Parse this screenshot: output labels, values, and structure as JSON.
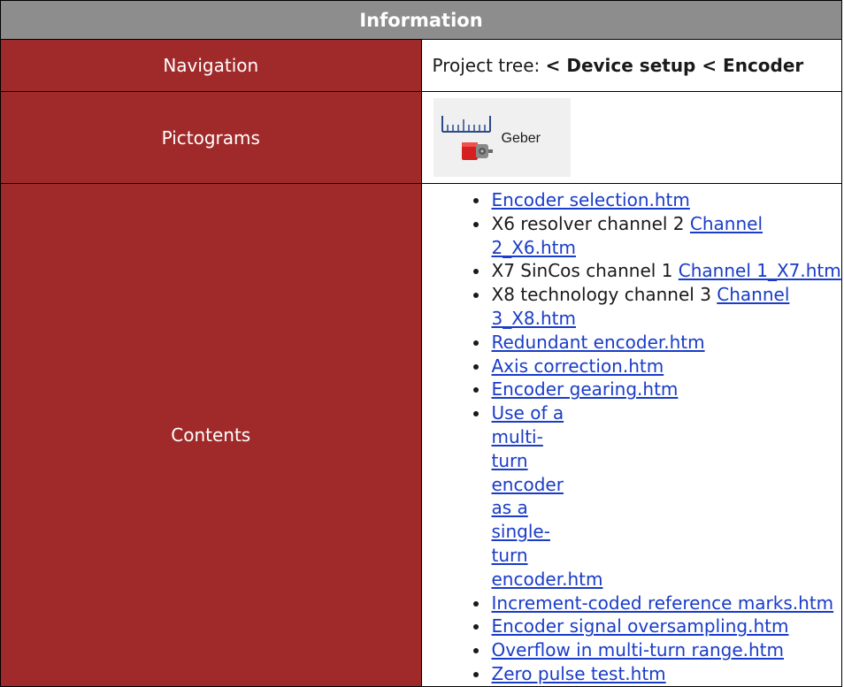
{
  "header": {
    "title": "Information"
  },
  "navigation": {
    "label": "Navigation",
    "prefix": "Project tree: ",
    "path": "< Device setup < Encoder"
  },
  "pictograms": {
    "label": "Pictograms",
    "icon_name": "encoder-icon",
    "caption": "Geber"
  },
  "contents": {
    "label": "Contents",
    "items": [
      {
        "prefix": "",
        "link": "Encoder selection.htm"
      },
      {
        "prefix": "X6 resolver channel 2 ",
        "link": "Channel 2_X6.htm"
      },
      {
        "prefix": "X7 SinCos channel 1 ",
        "link": "Channel 1_X7.htm"
      },
      {
        "prefix": "X8 technology channel 3 ",
        "link": "Channel 3_X8.htm"
      },
      {
        "prefix": "",
        "link": "Redundant encoder.htm"
      },
      {
        "prefix": "",
        "link": "Axis correction.htm"
      },
      {
        "prefix": "",
        "link": "Encoder gearing.htm"
      },
      {
        "prefix": "",
        "link": "Use of a multi-turn encoder as a single-turn encoder.htm"
      },
      {
        "prefix": "",
        "link": "Increment-coded reference marks.htm"
      },
      {
        "prefix": "",
        "link": "Encoder signal oversampling.htm"
      },
      {
        "prefix": "",
        "link": "Overflow in multi-turn range.htm"
      },
      {
        "prefix": "",
        "link": "Zero pulse test.htm"
      }
    ]
  },
  "colors": {
    "header_bg": "#8d8d8d",
    "label_bg": "#a02a2a",
    "link": "#1a3cc8"
  }
}
